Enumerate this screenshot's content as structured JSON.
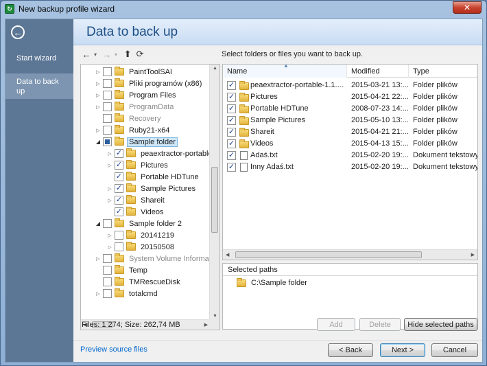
{
  "window": {
    "title": "New backup profile wizard",
    "close_glyph": "✕"
  },
  "sidebar": {
    "back_glyph": "←",
    "items": [
      {
        "label": "Start wizard"
      },
      {
        "label": "Data to back up"
      }
    ]
  },
  "header": {
    "title": "Data to back up"
  },
  "toolbar": {
    "back_glyph": "←",
    "forward_glyph": "→",
    "up_glyph": "⬆",
    "refresh_glyph": "⟳",
    "caret_glyph": "▾"
  },
  "instruction": "Select folders or files you want to back up.",
  "tree": {
    "items": [
      {
        "label": "PaintToolSAI",
        "checked": false,
        "dim": false,
        "level": 0,
        "expander": "▷"
      },
      {
        "label": "Pliki programów (x86)",
        "checked": false,
        "dim": false,
        "level": 0,
        "expander": "▷"
      },
      {
        "label": "Program Files",
        "checked": false,
        "dim": false,
        "level": 0,
        "expander": "▷"
      },
      {
        "label": "ProgramData",
        "checked": false,
        "dim": true,
        "level": 0,
        "expander": "▷"
      },
      {
        "label": "Recovery",
        "checked": false,
        "dim": true,
        "level": 0,
        "expander": ""
      },
      {
        "label": "Ruby21-x64",
        "checked": false,
        "dim": false,
        "level": 0,
        "expander": "▷"
      },
      {
        "label": "Sample folder",
        "checked": "partial",
        "dim": false,
        "level": 0,
        "expander": "◢",
        "selected": true
      },
      {
        "label": "peaextractor-portable",
        "checked": true,
        "dim": false,
        "level": 1,
        "expander": "▷"
      },
      {
        "label": "Pictures",
        "checked": true,
        "dim": false,
        "level": 1,
        "expander": "▷"
      },
      {
        "label": "Portable HDTune",
        "checked": true,
        "dim": false,
        "level": 1,
        "expander": ""
      },
      {
        "label": "Sample Pictures",
        "checked": true,
        "dim": false,
        "level": 1,
        "expander": "▷"
      },
      {
        "label": "Shareit",
        "checked": true,
        "dim": false,
        "level": 1,
        "expander": "▷"
      },
      {
        "label": "Videos",
        "checked": true,
        "dim": false,
        "level": 1,
        "expander": ""
      },
      {
        "label": "Sample folder 2",
        "checked": false,
        "dim": false,
        "level": 0,
        "expander": "◢"
      },
      {
        "label": "20141219",
        "checked": false,
        "dim": false,
        "level": 1,
        "expander": "▷"
      },
      {
        "label": "20150508",
        "checked": false,
        "dim": false,
        "level": 1,
        "expander": "▷"
      },
      {
        "label": "System Volume Informat",
        "checked": false,
        "dim": true,
        "level": 0,
        "expander": "▷"
      },
      {
        "label": "Temp",
        "checked": false,
        "dim": false,
        "level": 0,
        "expander": ""
      },
      {
        "label": "TMRescueDisk",
        "checked": false,
        "dim": false,
        "level": 0,
        "expander": ""
      },
      {
        "label": "totalcmd",
        "checked": false,
        "dim": false,
        "level": 0,
        "expander": "▷"
      }
    ]
  },
  "list": {
    "columns": [
      "Name",
      "Modified",
      "Type"
    ],
    "rows": [
      {
        "name": "peaextractor-portable-1.1....",
        "modified": "2015-03-21 13:...",
        "type": "Folder plików",
        "icon": "folder"
      },
      {
        "name": "Pictures",
        "modified": "2015-04-21 22:...",
        "type": "Folder plików",
        "icon": "folder"
      },
      {
        "name": "Portable HDTune",
        "modified": "2008-07-23 14:...",
        "type": "Folder plików",
        "icon": "folder"
      },
      {
        "name": "Sample Pictures",
        "modified": "2015-05-10 13:...",
        "type": "Folder plików",
        "icon": "folder"
      },
      {
        "name": "Shareit",
        "modified": "2015-04-21 21:...",
        "type": "Folder plików",
        "icon": "folder"
      },
      {
        "name": "Videos",
        "modified": "2015-04-13 15:...",
        "type": "Folder plików",
        "icon": "folder"
      },
      {
        "name": "Adaś.txt",
        "modified": "2015-02-20 19:...",
        "type": "Dokument tekstowy",
        "icon": "file"
      },
      {
        "name": "Inny Adaś.txt",
        "modified": "2015-02-20 19:...",
        "type": "Dokument tekstowy",
        "icon": "file"
      }
    ]
  },
  "selected_paths": {
    "header": "Selected paths",
    "items": [
      "C:\\Sample folder"
    ]
  },
  "status": "Files: 1 274; Size: 262,74 MB",
  "buttons": {
    "add": "Add",
    "delete": "Delete",
    "hide_paths": "Hide selected paths",
    "back": "< Back",
    "next": "Next >",
    "cancel": "Cancel"
  },
  "preview_link": "Preview source files",
  "scroll": {
    "tree_v_position": 0.55,
    "list_h_position": 0.0
  }
}
